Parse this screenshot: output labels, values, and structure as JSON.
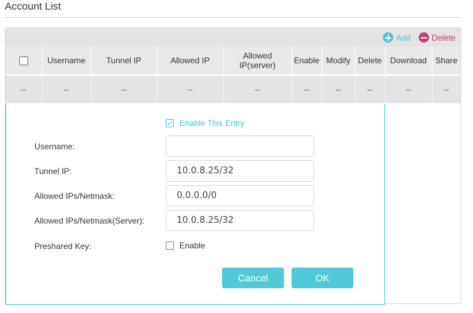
{
  "section_title": "Account List",
  "toolbar": {
    "add_label": "Add",
    "delete_label": "Delete",
    "add_icon": "plus-circle-icon",
    "delete_icon": "minus-circle-icon",
    "colors": {
      "add": "#4ac3d0",
      "delete": "#c24077"
    }
  },
  "table": {
    "columns": [
      "Username",
      "Tunnel IP",
      "Allowed IP",
      "Allowed IP(server)",
      "Enable",
      "Modify",
      "Delete",
      "Download",
      "Share"
    ],
    "rows": [
      [
        "--",
        "--",
        "--",
        "--",
        "--",
        "--",
        "--",
        "--",
        "--",
        "--"
      ]
    ]
  },
  "form": {
    "enable_entry_label": "Enable This Entry",
    "enable_entry_checked": true,
    "fields": {
      "username": {
        "label": "Username:",
        "value": ""
      },
      "tunnel_ip": {
        "label": "Tunnel IP:",
        "value": "10.0.8.25/32"
      },
      "allowed_ips": {
        "label": "Allowed IPs/Netmask:",
        "value": "0.0.0.0/0"
      },
      "allowed_ips_server": {
        "label": "Allowed IPs/Netmask(Server):",
        "value": "10.0.8.25/32"
      }
    },
    "preshared_key": {
      "label": "Preshared Key:",
      "option_label": "Enable",
      "checked": false
    },
    "cancel_label": "Cancel",
    "ok_label": "OK"
  },
  "accent_color": "#4ac3d0"
}
